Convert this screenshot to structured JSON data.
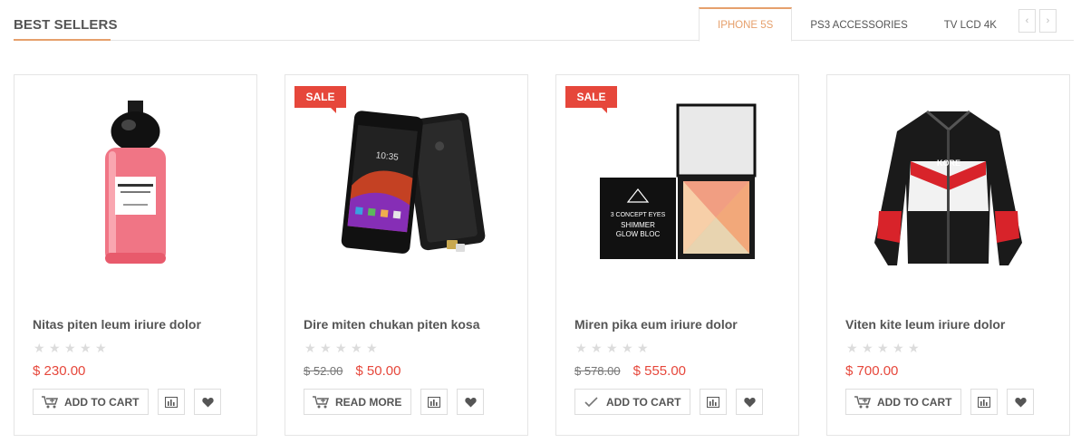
{
  "section": {
    "title": "BEST SELLERS"
  },
  "tabs": [
    {
      "label": "IPHONE 5S",
      "active": true
    },
    {
      "label": "PS3 ACCESSORIES",
      "active": false
    },
    {
      "label": "TV LCD 4K",
      "active": false
    }
  ],
  "nav": {
    "prev_icon": "chevron-left-icon",
    "next_icon": "chevron-right-icon",
    "prev": "‹",
    "next": "›"
  },
  "products": [
    {
      "name": "Nitas piten leum iriure dolor",
      "badge": "",
      "old_price": "",
      "price": "$ 230.00",
      "rating": 0,
      "action_label": "ADD TO CART",
      "action_icon": "cart-icon"
    },
    {
      "name": "Dire miten chukan piten kosa",
      "badge": "SALE",
      "old_price": "$ 52.00",
      "price": "$ 50.00",
      "rating": 0,
      "action_label": "READ MORE",
      "action_icon": "cart-icon"
    },
    {
      "name": "Miren pika eum iriure dolor",
      "badge": "SALE",
      "old_price": "$ 578.00",
      "price": "$ 555.00",
      "rating": 0,
      "action_label": "ADD TO CART",
      "action_icon": "check-icon"
    },
    {
      "name": "Viten kite leum iriure dolor",
      "badge": "",
      "old_price": "",
      "price": "$ 700.00",
      "rating": 0,
      "action_label": "ADD TO CART",
      "action_icon": "cart-icon"
    }
  ],
  "colors": {
    "accent": "#e6a06c",
    "sale": "#e6473b",
    "border": "#e5e5e5"
  }
}
